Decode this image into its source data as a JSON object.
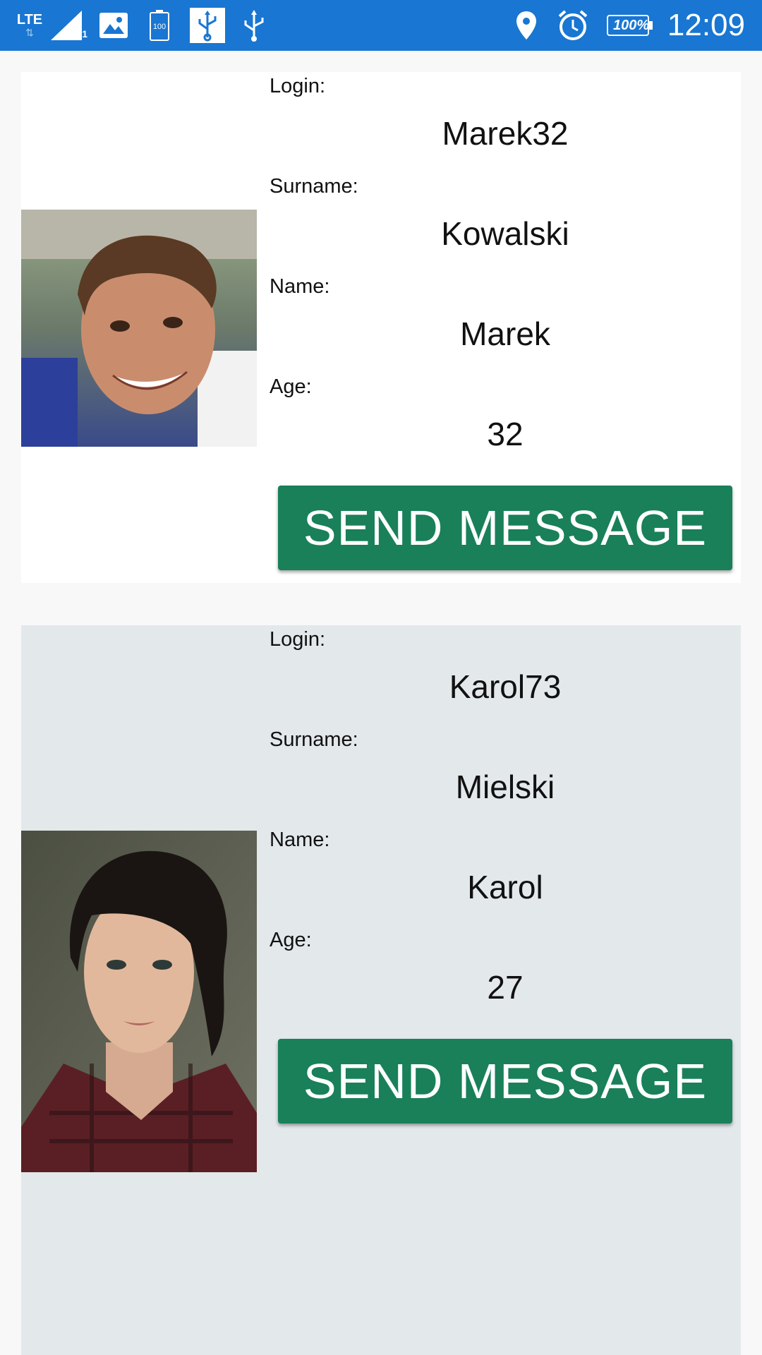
{
  "status_bar": {
    "network": "LTE",
    "sim_index": "1",
    "battery_level": "100",
    "battery_percent": "100%",
    "time": "12:09",
    "icons": [
      "lte-icon",
      "signal-icon",
      "image-icon",
      "battery-saver-icon",
      "usb-debug-icon",
      "usb-icon",
      "location-icon",
      "alarm-icon",
      "battery-icon"
    ],
    "color": "#1976d2"
  },
  "labels": {
    "login": "Login:",
    "surname": "Surname:",
    "name": "Name:",
    "age": "Age:"
  },
  "users": [
    {
      "login": "Marek32",
      "surname": "Kowalski",
      "name": "Marek",
      "age": "32",
      "button": "SEND MESSAGE",
      "card_color": "#ffffff"
    },
    {
      "login": "Karol73",
      "surname": "Mielski",
      "name": "Karol",
      "age": "27",
      "button": "SEND MESSAGE",
      "card_color": "#e3e8eb"
    }
  ],
  "button_color": "#198059"
}
